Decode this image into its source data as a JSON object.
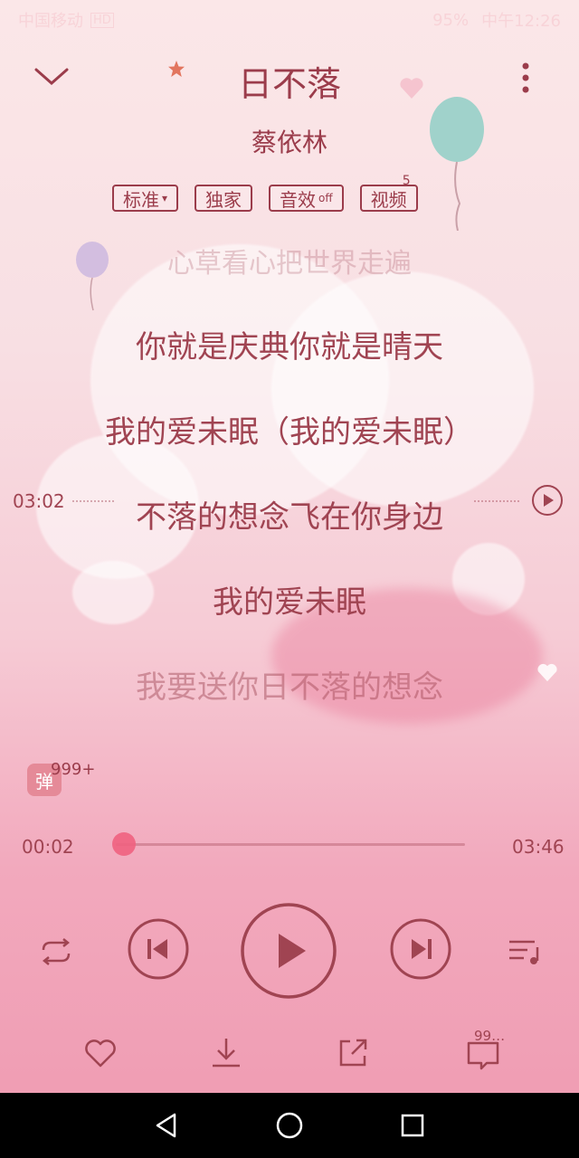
{
  "statusbar": {
    "carrier": "中国移动",
    "network": "HD",
    "battery": "95%",
    "time": "中午12:26"
  },
  "header": {
    "collapse_icon": "chevron-down-icon",
    "more_icon": "more-vertical-icon",
    "song_title": "日不落",
    "artist": "蔡依林"
  },
  "chips": [
    {
      "label": "标准",
      "suffix": "▾"
    },
    {
      "label": "独家",
      "suffix": ""
    },
    {
      "label": "音效",
      "suffix": "off"
    },
    {
      "label": "视频",
      "suffix": "",
      "badge": "5"
    }
  ],
  "lyrics": {
    "prev_faded": "心草看心把世界走遍",
    "line1": "你就是庆典你就是晴天",
    "line2": "我的爱未眠（我的爱未眠）",
    "current": "不落的想念飞在你身边",
    "line4": "我的爱未眠",
    "next_dim": "我要送你日不落的想念"
  },
  "seek_marker": {
    "time": "03:02",
    "play_icon": "play-circle-icon"
  },
  "danmu": {
    "label": "弹",
    "count": "999+"
  },
  "progress": {
    "elapsed": "00:02",
    "total": "03:46",
    "fraction": 0.009
  },
  "controls": {
    "repeat_icon": "repeat-icon",
    "prev_icon": "skip-previous-icon",
    "play_icon": "play-icon",
    "next_icon": "skip-next-icon",
    "playlist_icon": "playlist-icon"
  },
  "bottom_actions": {
    "like_icon": "heart-icon",
    "download_icon": "download-icon",
    "share_icon": "share-icon",
    "comment_count": "99…"
  },
  "colors": {
    "accent": "#9b3c4b",
    "thumb": "#f0627f"
  }
}
